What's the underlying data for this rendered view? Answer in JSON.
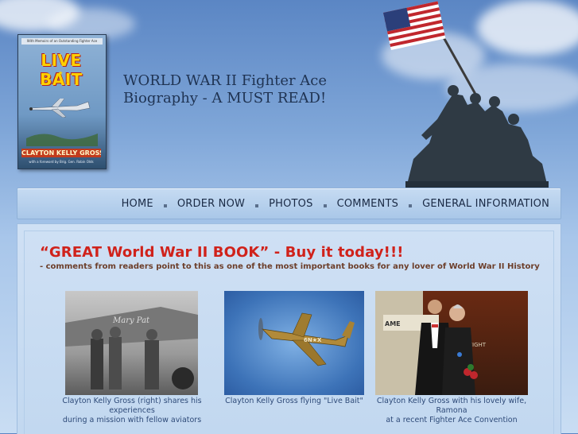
{
  "book_cover": {
    "top_strip": "With Memoirs of an Outstanding Fighter Ace",
    "title": "LIVE BAIT",
    "author": "CLAYTON KELLY GROSS",
    "subtitle": "with a foreword by Brig. Gen. Robin Olds"
  },
  "tagline": {
    "line1": "WORLD WAR II Fighter Ace",
    "line2": "Biography - A MUST READ!"
  },
  "nav": {
    "items": [
      "HOME",
      "ORDER NOW",
      "PHOTOS",
      "COMMENTS",
      "GENERAL INFORMATION"
    ]
  },
  "main": {
    "headline": "“GREAT World War II BOOK” - Buy it today!!!",
    "subline": "- comments from readers point to this as one of the most important books for any lover of World War II History",
    "photos": [
      {
        "icon": "aviators-photo",
        "caption_line1": "Clayton Kelly Gross (right) shares his experiences",
        "caption_line2": "during a mission with fellow aviators"
      },
      {
        "icon": "p51-mustang-photo",
        "caption_line1": "Clayton Kelly Gross flying \"Live Bait\"",
        "caption_line2": ""
      },
      {
        "icon": "couple-photo",
        "caption_line1": "Clayton Kelly Gross with his lovely wife, Ramona",
        "caption_line2": "at a recent Fighter Ace Convention"
      }
    ]
  },
  "colors": {
    "headline": "#d0221b",
    "subline": "#6c3e2a",
    "caption": "#2e4a78",
    "nav_text": "#1a2a45"
  }
}
